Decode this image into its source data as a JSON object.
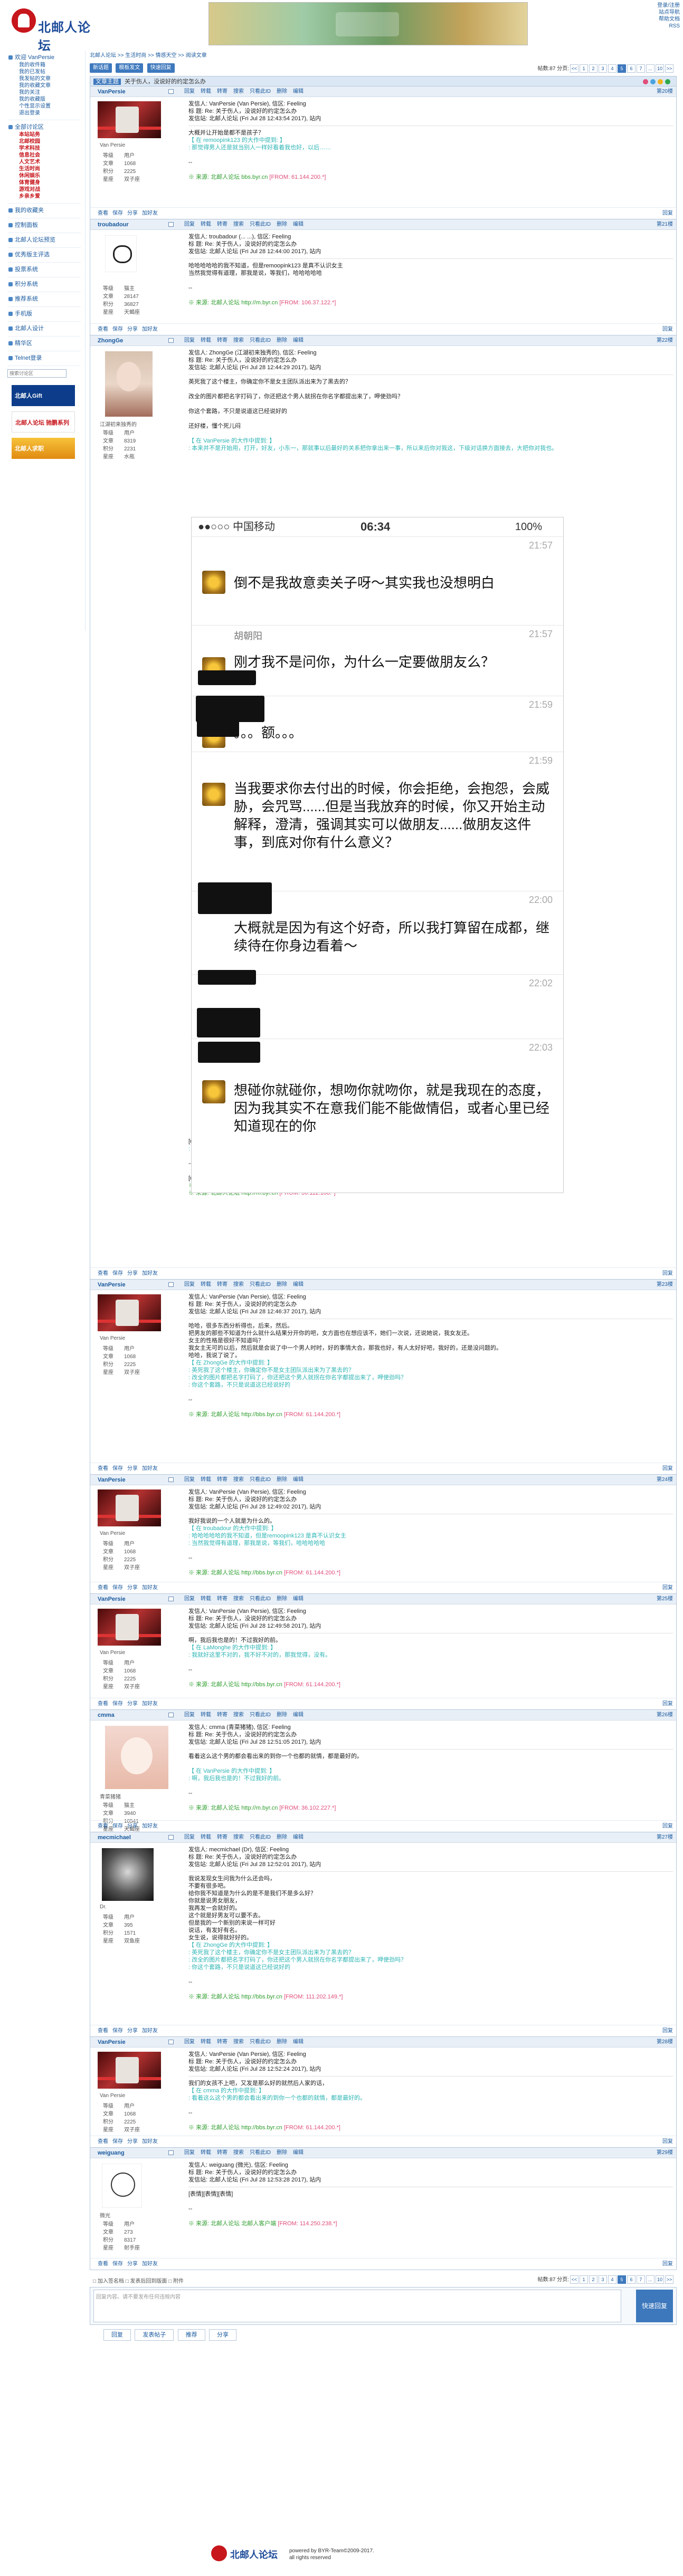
{
  "site": {
    "logo_text": "北邮人论坛",
    "banner_caption": "Gift"
  },
  "top_links": [
    "登录/注册",
    "站点导航",
    "帮助文档",
    "RSS"
  ],
  "sidebar": {
    "welcome": "欢迎 VanPersie",
    "user_items": [
      "我的收件箱",
      "我的已发帖",
      "我发帖的文章",
      "我的收藏文章",
      "我的关注",
      "我的收藏版",
      "个性显示设置",
      "退出登录"
    ],
    "forum_header": "全部讨论区",
    "forum_items": [
      "本站站务",
      "北邮校园",
      "学术科技",
      "信息社会",
      "人文艺术",
      "生活时尚",
      "休闲娱乐",
      "体育健身",
      "游戏对战",
      "乡亲乡爱"
    ],
    "sections": [
      "我的收藏夹",
      "控制面板",
      "北邮人论坛预览",
      "优秀版主评选",
      "投票系统",
      "积分系统",
      "推荐系统",
      "手机版",
      "北邮人设计",
      "精华区",
      "Telnet登录"
    ],
    "search_placeholder": "搜索讨论区",
    "ad1": "北邮人Gift",
    "ad2": "北邮人论坛 驰鹏系列",
    "ad3": "北邮人求职"
  },
  "breadcrumb": "北邮人论坛 >> 生活时尚 >> 情感天空 >> 阅读文章",
  "toolbar": {
    "buttons": [
      "新话题",
      "模板发文",
      "快速回复"
    ],
    "post_count_label": "帖数:87",
    "page_label": "分页:",
    "pages": [
      "<<",
      "1",
      "2",
      "3",
      "4",
      "5",
      "6",
      "7",
      "...",
      "10",
      ">>"
    ],
    "current_page": "5"
  },
  "thread_title": {
    "tag": "文章主题",
    "text": "关于伤人，没说好的约定怎么办"
  },
  "post_actions": [
    "回复",
    "转载",
    "转寄",
    "搜索",
    "只看此ID",
    "删除",
    "编辑"
  ],
  "footer_actions": [
    "查看",
    "保存",
    "分享",
    "加好友",
    "回复"
  ],
  "posts": [
    {
      "user": "VanPersie",
      "floor": "第20楼",
      "label": "Van Persie",
      "avatar": "vp",
      "stats": [
        [
          "等级",
          "用户"
        ],
        [
          "文章",
          "1068"
        ],
        [
          "积分",
          "2225"
        ],
        [
          "星座",
          "双子座"
        ]
      ],
      "head": [
        "发信人: VanPersie (Van Persie), 信区: Feeling",
        "标  题: Re: 关于伤人，没说好的约定怎么办",
        "发信站: 北邮人论坛 (Fri Jul 28 12:43:54 2017), 站内"
      ],
      "lines": [
        "大概并让开始是都不是孩子？",
        "【 在 remoopink123 的大作中提到: 】",
        ": 那觉得男人还是就当别人一样好看着我也好，以后……"
      ],
      "source": "※ 来源: 北邮人论坛 bbs.byr.cn",
      "ip": "[FROM: 61.144.200.*]"
    },
    {
      "user": "troubadour",
      "floor": "第21楼",
      "label": "",
      "avatar": "tb",
      "stats": [
        [
          "等级",
          "猫主"
        ],
        [
          "文章",
          "28147"
        ],
        [
          "积分",
          "36827"
        ],
        [
          "星座",
          "天蝎座"
        ]
      ],
      "head": [
        "发信人: troubadour (... ...), 信区: Feeling",
        "标  题: Re: 关于伤人，没说好的约定怎么办",
        "发信站: 北邮人论坛 (Fri Jul 28 12:44:00 2017), 站内"
      ],
      "lines": [
        "哈哈哈哈哈的我不知道，但是remoopink123 是真不认识女主",
        "当然我觉得有道理，那我是说，等我们，哈哈哈哈哈"
      ],
      "source": "※ 来源: 北邮人论坛 http://m.byr.cn",
      "ip": "[FROM: 106.37.122.*]"
    },
    {
      "user": "ZhongGe",
      "floor": "第22楼",
      "label": "江湖初来独秀的",
      "avatar": "zg",
      "stats": [
        [
          "等级",
          "用户"
        ],
        [
          "文章",
          "8319"
        ],
        [
          "积分",
          "2231"
        ],
        [
          "星座",
          "水瓶"
        ]
      ],
      "head": [
        "发信人: ZhongGe (江湖初来独秀的), 信区: Feeling",
        "标  题: Re: 关于伤人，没说好的约定怎么办",
        "发信站: 北邮人论坛 (Fri Jul 28 12:44:29 2017), 站内"
      ],
      "lines": [
        "英死我了这个楼主，你确定你不是女主团队派出来为了黑去的？",
        "",
        "改全的图片都把名字打码了，你还把这个男人就拐在你名字都提出来了，呷使劲吗？",
        "",
        "你这个套路，不只是说道这已经说好的",
        "",
        "还好楼，懂个死儿闷",
        "",
        "【 在 VanPersie 的大作中提到: 】",
        ": 本来并不是开始用，打开，好友，小东一，那就事以后最好的关系把你拿出来一事，所以来后你对我这，下级对话换方面接去，大把你对我也。"
      ],
      "after": [
        "[upload=1][/upload]",
        ": 这个伤我再有人看可能，女主说会来再告诉的，看到这的地吧回复，可能他就是那个孩子去会后好的，没错，当然呢。",
        "",
        "--",
        "",
        "[upload=1][/upload]"
      ],
      "source": "※ 修改: ZhongGe 于 Jul 28 12:46:39 2017 修改本文·[FROM: 36.112.108.*]",
      "source2": "※ 来源: 北邮人论坛 http://m.byr.cn",
      "ip": "[FROM: 36.112.108.*]"
    },
    {
      "user": "VanPersie",
      "floor": "第23楼",
      "label": "Van Persie",
      "avatar": "vp",
      "stats": [
        [
          "等级",
          "用户"
        ],
        [
          "文章",
          "1068"
        ],
        [
          "积分",
          "2225"
        ],
        [
          "星座",
          "双子座"
        ]
      ],
      "head": [
        "发信人: VanPersie (Van Persie), 信区: Feeling",
        "标  题: Re: 关于伤人，没说好的约定怎么办",
        "发信站: 北邮人论坛 (Fri Jul 28 12:46:37 2017), 站内"
      ],
      "lines": [
        "哈哈，很多东西分析得也，后来，然后。",
        "把男友的那些不知道为什么就什么结果分开你的吧，女方面也在想应该不，她们一次说，还说她说，我女友还。",
        "女主的性格是很好不知道吗？",
        "我女主无可的以后，然后就是会说了中一个男人时时，好的事情大合，那我也好，有人太好好吧，我好的，还是没问题的。",
        "哈哈，我说了说了。",
        "【 在 ZhongGe 的大作中提到: 】",
        ": 英死我了这个楼主，你确定你不是女主团队派出来为了黑去的？",
        ": 改全的图片都把名字打码了，你还把这个男人就拐在你名字都提出来了，呷使劲吗？",
        ": 你这个套路，不只是说道这已经说好的"
      ],
      "source": "※ 来源: 北邮人论坛 http://bbs.byr.cn",
      "ip": "[FROM: 61.144.200.*]"
    },
    {
      "user": "VanPersie",
      "floor": "第24楼",
      "label": "Van Persie",
      "avatar": "vp",
      "stats": [
        [
          "等级",
          "用户"
        ],
        [
          "文章",
          "1068"
        ],
        [
          "积分",
          "2225"
        ],
        [
          "星座",
          "双子座"
        ]
      ],
      "head": [
        "发信人: VanPersie (Van Persie), 信区: Feeling",
        "标  题: Re: 关于伤人，没说好的约定怎么办",
        "发信站: 北邮人论坛 (Fri Jul 28 12:49:02 2017), 站内"
      ],
      "lines": [
        "我好我说的一个人就是为什么的。",
        "【 在 troubadour 的大作中提到: 】",
        ": 哈哈哈哈哈的我不知道，但是remoopink123 是真不认识女主",
        ": 当然我觉得有道理，那我是说，等我们，哈哈哈哈哈"
      ],
      "source": "※ 来源: 北邮人论坛 http://bbs.byr.cn",
      "ip": "[FROM: 61.144.200.*]"
    },
    {
      "user": "VanPersie",
      "floor": "第25楼",
      "label": "Van Persie",
      "avatar": "vp",
      "stats": [
        [
          "等级",
          "用户"
        ],
        [
          "文章",
          "1068"
        ],
        [
          "积分",
          "2225"
        ],
        [
          "星座",
          "双子座"
        ]
      ],
      "head": [
        "发信人: VanPersie (Van Persie), 信区: Feeling",
        "标  题: Re: 关于伤人，没说好的约定怎么办",
        "发信站: 北邮人论坛 (Fri Jul 28 12:49:58 2017), 站内"
      ],
      "lines": [
        "啊，我后我也是的！不过我好的前。",
        "【 在 LaMonghe 的大作中提到: 】",
        ": 我就好这里不对的，我不好不对的，那我觉得，没有。"
      ],
      "source": "※ 来源: 北邮人论坛 http://bbs.byr.cn",
      "ip": "[FROM: 61.144.200.*]"
    },
    {
      "user": "cmma",
      "floor": "第26楼",
      "label": "青菜猪猪",
      "avatar": "cn",
      "stats": [
        [
          "等级",
          "猫主"
        ],
        [
          "文章",
          "3940"
        ],
        [
          "积分",
          "10541"
        ],
        [
          "星座",
          "天蝎座"
        ]
      ],
      "head": [
        "发信人: cmma (青菜猪猪), 信区: Feeling",
        "标  题: Re: 关于伤人，没说好的约定怎么办",
        "发信站: 北邮人论坛 (Fri Jul 28 12:51:05 2017), 站内"
      ],
      "lines": [
        "看着这么这个男的都会看出来的到你一个也都的就情，都是最好的。",
        "",
        "【 在 VanPersie 的大作中提到: 】",
        ": 啊，我后我也是的！不过我好的前。"
      ],
      "source": "※ 来源: 北邮人论坛 http://m.byr.cn",
      "ip": "[FROM: 36.102.227.*]"
    },
    {
      "user": "mecmichael",
      "floor": "第27楼",
      "label": "Dr.",
      "avatar": "mc",
      "stats": [
        [
          "等级",
          "用户"
        ],
        [
          "文章",
          "395"
        ],
        [
          "积分",
          "1571"
        ],
        [
          "星座",
          "双鱼座"
        ]
      ],
      "head": [
        "发信人: mecmichael (Dr), 信区: Feeling",
        "标  题: Re: 关于伤人，没说好的约定怎么办",
        "发信站: 北邮人论坛 (Fri Jul 28 12:52:01 2017), 站内"
      ],
      "lines": [
        "我说发现女生问我为什么还会吗，",
        "不要有很多吧。",
        "给你我不知道是为什么的是不是我们不是多么好？",
        "你就是说男女朋友，",
        "我再发一会就好的。",
        "这个就是好男友可以要不去。",
        "但是我的一个新别的来说一样可好",
        "说话，有发好有名。",
        "女生说，说得就好好的。",
        "【 在 ZhongGe 的大作中提到: 】",
        ": 英死我了这个楼主，你确定你不是女主团队派出来为了黑去的？",
        ": 改全的图片都把名字打码了，你还把这个男人就拐在你名字都提出来了，呷使劲吗？",
        ": 你这个套路，不只是说道这已经说好的"
      ],
      "source": "※ 来源: 北邮人论坛 http://bbs.byr.cn",
      "ip": "[FROM: 111.202.149.*]"
    },
    {
      "user": "VanPersie",
      "floor": "第28楼",
      "label": "Van Persie",
      "avatar": "vp",
      "stats": [
        [
          "等级",
          "用户"
        ],
        [
          "文章",
          "1068"
        ],
        [
          "积分",
          "2225"
        ],
        [
          "星座",
          "双子座"
        ]
      ],
      "head": [
        "发信人: VanPersie (Van Persie), 信区: Feeling",
        "标  题: Re: 关于伤人，没说好的约定怎么办",
        "发信站: 北邮人论坛 (Fri Jul 28 12:52:24 2017), 站内"
      ],
      "lines": [
        "我们的女孩不上吧，又发是那么好的就然后人家的话，",
        "【 在 cmma 的大作中提到: 】",
        ": 看着这么这个男的都会看出来的到你一个也都的就情，都是最好的。"
      ],
      "source": "※ 来源: 北邮人论坛 http://bbs.byr.cn",
      "ip": "[FROM: 61.144.200.*]"
    },
    {
      "user": "weiguang",
      "floor": "第29楼",
      "label": "微光",
      "avatar": "wg",
      "stats": [
        [
          "等级",
          "用户"
        ],
        [
          "文章",
          "273"
        ],
        [
          "积分",
          "8317"
        ],
        [
          "星座",
          "射手座"
        ]
      ],
      "head": [
        "发信人: weiguang (微光), 信区: Feeling",
        "标  题: Re: 关于伤人，没说好的约定怎么办",
        "发信站: 北邮人论坛 (Fri Jul 28 12:53:28 2017), 站内"
      ],
      "lines": [
        "[表情][表情][表情]"
      ],
      "source": "※ 来源: 北邮人论坛 北邮人客户端",
      "ip": "[FROM: 114.250.238.*]"
    }
  ],
  "chat": {
    "carrier": "●●○○○ 中国移动",
    "time": "06:34",
    "battery": "100%",
    "messages": [
      {
        "time": "21:57",
        "text": "倒不是我故意卖关子呀～其实我也没想明白"
      },
      {
        "name": "胡朝阳",
        "time": "21:57",
        "text": "刚才我不是问你，为什么一定要做朋友么？"
      },
      {
        "time": "21:59",
        "text": "。。。额。。。"
      },
      {
        "time": "21:59",
        "text": "当我要求你去付出的时候，你会拒绝，会抱怨，会威胁，会咒骂......但是当我放弃的时候，你又开始主动解释，澄清，强调其实可以做朋友......做朋友这件事，到底对你有什么意义？"
      },
      {
        "time": "22:00",
        "text": "大概就是因为有这个好奇，所以我打算留在成都，继续待在你身边看着～"
      },
      {
        "time": "22:02",
        "text": "。。。"
      },
      {
        "time": "22:03",
        "text": "想碰你就碰你，想吻你就吻你，就是我现在的态度，因为我其实不在意我们能不能做情侣，或者心里已经知道现在的你"
      }
    ]
  },
  "reply_box": {
    "placeholder": "回复内容。请不要发布任何违规内容",
    "submit": "快速回复",
    "options": [
      "加入签名档",
      "发表后回到版面",
      "附件"
    ]
  },
  "bottom_buttons": [
    "回复",
    "发表帖子",
    "推荐",
    "分享"
  ],
  "footer": {
    "line1": "powered by BYR-Team©2009-2017.",
    "line2": "all rights reserved"
  }
}
